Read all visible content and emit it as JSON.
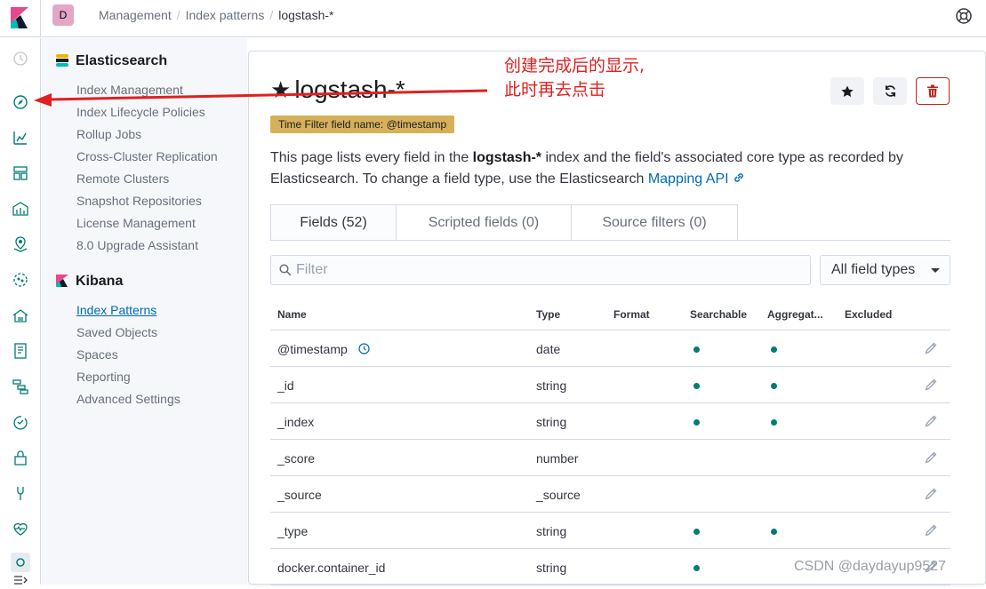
{
  "header": {
    "space_initial": "D",
    "breadcrumbs": [
      "Management",
      "Index patterns",
      "logstash-*"
    ]
  },
  "navrail": {
    "icons": [
      "recently-viewed-icon",
      "discover-icon",
      "visualize-icon",
      "dashboard-icon",
      "canvas-icon",
      "maps-icon",
      "ml-icon",
      "infrastructure-icon",
      "logs-icon",
      "apm-icon",
      "uptime-icon",
      "siem-icon",
      "dev-tools-icon",
      "monitoring-icon",
      "management-icon",
      "collapse-icon"
    ]
  },
  "sidenav": {
    "elasticsearch": {
      "title": "Elasticsearch",
      "items": [
        "Index Management",
        "Index Lifecycle Policies",
        "Rollup Jobs",
        "Cross-Cluster Replication",
        "Remote Clusters",
        "Snapshot Repositories",
        "License Management",
        "8.0 Upgrade Assistant"
      ]
    },
    "kibana": {
      "title": "Kibana",
      "items": [
        "Index Patterns",
        "Saved Objects",
        "Spaces",
        "Reporting",
        "Advanced Settings"
      ],
      "active": "Index Patterns"
    }
  },
  "main": {
    "title_star": "★",
    "title": "logstash-*",
    "badge": "Time Filter field name: @timestamp",
    "desc_before": "This page lists every field in the ",
    "desc_bold": "logstash-*",
    "desc_after": " index and the field's associated core type as recorded by Elasticsearch. To change a field type, use the Elasticsearch ",
    "desc_link": "Mapping API",
    "tabs": [
      "Fields (52)",
      "Scripted fields (0)",
      "Source filters (0)"
    ],
    "filter_placeholder": "Filter",
    "field_type_select": "All field types",
    "columns": [
      "Name",
      "Type",
      "Format",
      "Searchable",
      "Aggregat...",
      "Excluded"
    ],
    "rows": [
      {
        "name": "@timestamp",
        "type": "date",
        "searchable": true,
        "aggregatable": true
      },
      {
        "name": "_id",
        "type": "string",
        "searchable": true,
        "aggregatable": true
      },
      {
        "name": "_index",
        "type": "string",
        "searchable": true,
        "aggregatable": true
      },
      {
        "name": "_score",
        "type": "number",
        "searchable": false,
        "aggregatable": false
      },
      {
        "name": "_source",
        "type": "_source",
        "searchable": false,
        "aggregatable": false
      },
      {
        "name": "_type",
        "type": "string",
        "searchable": true,
        "aggregatable": true
      },
      {
        "name": "docker.container_id",
        "type": "string",
        "searchable": true,
        "aggregatable": false
      }
    ]
  },
  "annotation": {
    "line1": "创建完成后的显示,",
    "line2": "此时再去点击",
    "color": "#e02020"
  },
  "watermark": "CSDN @daydayup9527"
}
